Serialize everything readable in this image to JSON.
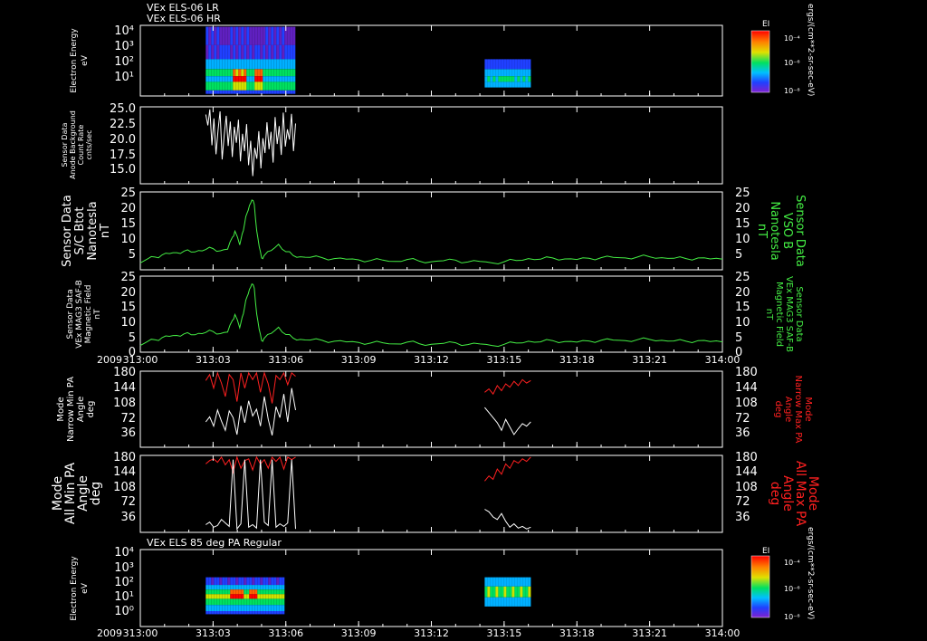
{
  "header": {
    "line1": "VEx ELS-06 LR",
    "line2": "VEx ELS-06 HR",
    "bottom_panel_title": "VEx ELS 85 deg PA Regular"
  },
  "colorbar": {
    "label": "EI",
    "units": "ergs/(cm**2-sr-sec-eV)",
    "ticks": [
      "10⁻⁴",
      "10⁻⁶",
      "10⁻⁸"
    ]
  },
  "x_axis": {
    "year": "2009",
    "tick_labels": [
      "313:00",
      "313:03",
      "313:06",
      "313:09",
      "313:12",
      "313:15",
      "313:18",
      "313:21",
      "314:00"
    ]
  },
  "chart_data": [
    {
      "type": "heatmap",
      "id": "spec-top",
      "ylabel": [
        "Electron Energy",
        "eV"
      ],
      "yscale": "log",
      "y_tick_labels": [
        "10⁴",
        "10³",
        "10²",
        "10¹"
      ],
      "coverage_minutes": [
        [
          2.7,
          6.4
        ],
        [
          14.2,
          16.1
        ]
      ],
      "colormap": [
        "#6020c0",
        "#2040ff",
        "#00b0ff",
        "#00e060",
        "#d0e000",
        "#ff6000",
        "#ff0000"
      ]
    },
    {
      "type": "line",
      "id": "sensor-bkg",
      "ylabel": [
        "Sensor Data",
        "Anode Background",
        "Count Rate",
        "cnts/sec"
      ],
      "y_tick_labels": [
        "25.0",
        "22.5",
        "20.0",
        "17.5",
        "15.0"
      ],
      "ylim": [
        13,
        25
      ],
      "color": "#ffffff",
      "x_minutes_range": [
        2.7,
        6.4
      ],
      "y": [
        23.8,
        22.1,
        24.6,
        19.0,
        23.2,
        17.6,
        21.4,
        24.3,
        16.8,
        20.5,
        23.6,
        18.9,
        22.7,
        17.2,
        21.9,
        19.4,
        23.0,
        16.5,
        20.8,
        18.1,
        22.3,
        15.9,
        19.7,
        14.2,
        18.6,
        16.9,
        21.2,
        15.4,
        20.1,
        17.8,
        22.6,
        18.4,
        21.1,
        16.3,
        23.4,
        19.2,
        22.0,
        17.5,
        24.1,
        18.8,
        21.5,
        19.9,
        23.9,
        18.1,
        22.4
      ]
    },
    {
      "type": "line",
      "id": "sc-btot",
      "ylabel": [
        "Sensor Data",
        "S/C Btot",
        "Nanotesla",
        "nT"
      ],
      "ylabel_right": [
        "Sensor Data",
        "VSO B",
        "Nanotesla",
        "nT"
      ],
      "y_tick_labels": [
        "25",
        "20",
        "15",
        "10",
        "5"
      ],
      "ylim": [
        0,
        25
      ],
      "color": "#44ee44",
      "x_minutes": [
        0,
        0.3,
        0.6,
        0.9,
        1.2,
        1.5,
        1.8,
        2.1,
        2.4,
        2.7,
        3.0,
        3.3,
        3.6,
        3.8,
        3.9,
        4.1,
        4.2,
        4.3,
        4.4,
        4.5,
        4.6,
        4.7,
        4.8,
        4.9,
        5.0,
        5.1,
        5.4,
        5.7,
        6.0,
        6.3,
        6.6,
        7.0,
        7.5,
        8.0,
        8.5,
        9.0,
        9.5,
        10.0,
        10.5,
        11.0,
        11.5,
        12.0,
        12.5,
        13.0,
        13.5,
        14.0,
        14.5,
        15.0,
        15.5,
        16.0,
        16.5,
        17.0,
        17.5,
        18.0,
        18.5,
        19.0,
        19.5,
        20.0,
        20.5,
        21.0,
        21.5,
        22.0,
        22.5,
        23.0,
        23.5,
        24.0
      ],
      "y": [
        2.2,
        3.5,
        4.1,
        4.8,
        5.2,
        5.5,
        6.0,
        5.7,
        6.2,
        6.5,
        6.8,
        6.1,
        6.6,
        10.5,
        12.4,
        8.0,
        11.5,
        14.8,
        18.2,
        20.7,
        22.4,
        21.0,
        12.5,
        7.5,
        3.8,
        4.5,
        6.2,
        8.2,
        5.8,
        4.6,
        4.2,
        4.0,
        3.9,
        3.6,
        3.4,
        3.2,
        3.0,
        3.1,
        2.7,
        3.3,
        2.8,
        2.6,
        2.9,
        3.1,
        2.5,
        2.7,
        2.2,
        2.6,
        3.0,
        3.6,
        3.4,
        3.8,
        3.5,
        3.3,
        3.7,
        3.9,
        4.0,
        3.8,
        4.1,
        4.2,
        3.9,
        3.7,
        3.6,
        3.8,
        3.5,
        3.4
      ]
    },
    {
      "type": "line",
      "id": "mag-field",
      "ylabel": [
        "Sensor Data",
        "VEx MAG3 SAF-B",
        "Magnetic Field",
        "nT"
      ],
      "ylabel_right": [
        "Sensor Data",
        "VEx MAG3 SAF-B",
        "Magnetic Field",
        "nT"
      ],
      "y_tick_labels": [
        "25",
        "20",
        "15",
        "10",
        "5",
        "0"
      ],
      "ylim": [
        0,
        25
      ],
      "color": "#44ee44",
      "same_series_as": "sc-btot"
    },
    {
      "type": "line",
      "id": "narrow-pa",
      "ylabel": [
        "Mode",
        "Narrow Min PA",
        "Angle",
        "deg"
      ],
      "ylabel_right": [
        "Mode",
        "Narrow Max PA",
        "Angle",
        "deg"
      ],
      "y_tick_labels": [
        "180",
        "144",
        "108",
        "72",
        "36"
      ],
      "ylim": [
        0,
        180
      ],
      "series": [
        {
          "color": "#ff2020",
          "segments": [
            [
              2.7,
              6.4,
              [
                158,
                172,
                140,
                176,
                152,
                120,
                172,
                160,
                108,
                176,
                140,
                176,
                160,
                176,
                130,
                176,
                150,
                104,
                170,
                160,
                176,
                148,
                176,
                168
              ]
            ],
            [
              14.2,
              16.1,
              [
                130,
                138,
                126,
                146,
                134,
                150,
                142,
                156,
                146,
                160,
                152,
                158
              ]
            ]
          ]
        },
        {
          "color": "#ffffff",
          "segments": [
            [
              2.7,
              6.4,
              [
                60,
                72,
                50,
                88,
                62,
                40,
                86,
                70,
                30,
                98,
                58,
                110,
                74,
                90,
                50,
                120,
                66,
                28,
                96,
                70,
                126,
                60,
                140,
                88
              ]
            ],
            [
              14.2,
              16.1,
              [
                94,
                82,
                70,
                58,
                40,
                66,
                48,
                30,
                44,
                56,
                50,
                60
              ]
            ]
          ]
        }
      ]
    },
    {
      "type": "line",
      "id": "all-pa",
      "ylabel": [
        "Mode",
        "All Min PA",
        "Angle",
        "deg"
      ],
      "ylabel_right": [
        "Mode",
        "All Max PA",
        "Angle",
        "deg"
      ],
      "y_tick_labels": [
        "180",
        "144",
        "108",
        "72",
        "36"
      ],
      "ylim": [
        0,
        180
      ],
      "series": [
        {
          "color": "#ff2020",
          "segments": [
            [
              2.7,
              6.4,
              [
                160,
                168,
                172,
                164,
                176,
                158,
                170,
                140,
                176,
                150,
                168,
                172,
                146,
                176,
                160,
                170,
                150,
                176,
                166,
                176,
                148,
                176,
                170,
                176
              ]
            ],
            [
              14.2,
              16.1,
              [
                120,
                132,
                124,
                148,
                136,
                160,
                150,
                168,
                162,
                172,
                166,
                176
              ]
            ]
          ]
        },
        {
          "color": "#ffffff",
          "segments": [
            [
              2.7,
              6.4,
              [
                18,
                24,
                12,
                16,
                30,
                22,
                14,
                170,
                8,
                20,
                170,
                12,
                18,
                10,
                170,
                24,
                16,
                170,
                12,
                20,
                14,
                22,
                170,
                8
              ]
            ],
            [
              14.2,
              16.1,
              [
                54,
                48,
                36,
                30,
                44,
                26,
                12,
                20,
                10,
                14,
                8,
                12
              ]
            ]
          ]
        }
      ]
    },
    {
      "type": "heatmap",
      "id": "spec-bottom",
      "ylabel": [
        "Electron Energy",
        "eV"
      ],
      "yscale": "log",
      "y_tick_labels": [
        "10⁴",
        "10³",
        "10²",
        "10¹",
        "10⁰"
      ],
      "coverage_minutes": [
        [
          2.7,
          6.0
        ],
        [
          14.2,
          16.1
        ]
      ],
      "colormap": [
        "#6020c0",
        "#2040ff",
        "#00b0ff",
        "#00e060",
        "#d0e000",
        "#ff6000",
        "#ff0000"
      ]
    }
  ]
}
